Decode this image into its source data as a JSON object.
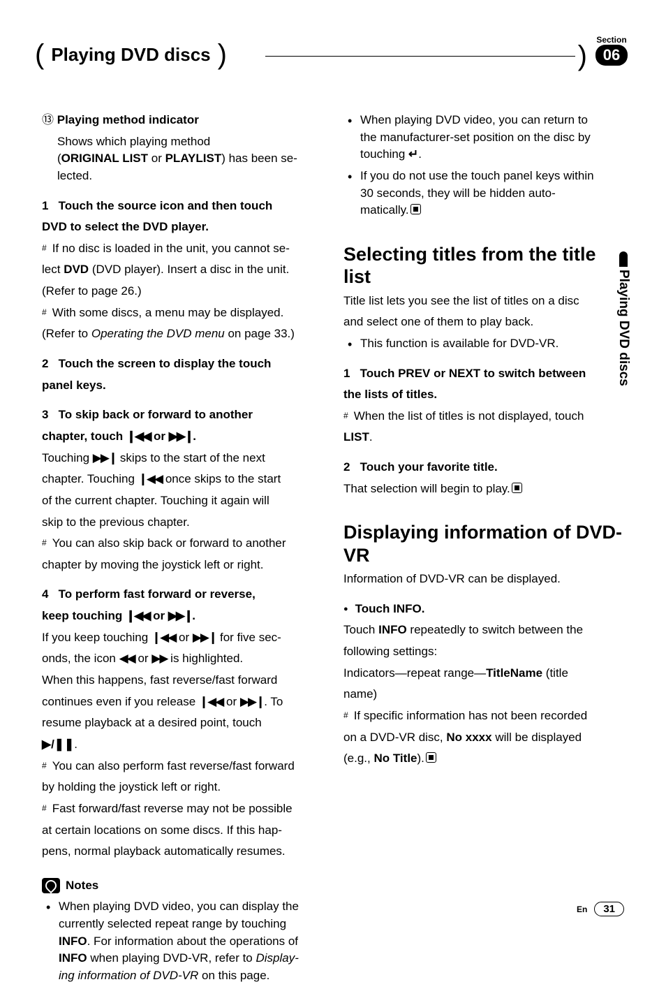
{
  "header": {
    "section_title": "Playing DVD discs",
    "section_label": "Section",
    "section_number": "06"
  },
  "side_tab": "Playing DVD discs",
  "left": {
    "item13_num": "⑬",
    "item13_title": "Playing method indicator",
    "item13_l1": "Shows which playing method",
    "item13_l2a": "(",
    "item13_l2b": "ORIGINAL LIST",
    "item13_l2c": " or ",
    "item13_l2d": "PLAYLIST",
    "item13_l2e": ") has been se-",
    "item13_l3": "lected.",
    "s1_num": "1",
    "s1_t1": "Touch the source icon and then touch",
    "s1_t2": "DVD to select the DVD player.",
    "s1_n1a": "If no disc is loaded in the unit, you cannot se-",
    "s1_n1b": "lect ",
    "s1_n1c": "DVD",
    "s1_n1d": " (DVD player). Insert a disc in the unit.",
    "s1_n1e": "(Refer to page 26.)",
    "s1_n2a": "With some discs, a menu may be displayed.",
    "s1_n2b": "(Refer to ",
    "s1_n2c": "Operating the DVD menu",
    "s1_n2d": " on page 33.)",
    "s2_num": "2",
    "s2_t1": "Touch the screen to display the touch",
    "s2_t2": "panel keys.",
    "s3_num": "3",
    "s3_t1": "To skip back or forward to another",
    "s3_t2a": "chapter, touch ",
    "s3_t2b": " or ",
    "s3_t2c": ".",
    "s3_b1a": "Touching ",
    "s3_b1b": " skips to the start of the next",
    "s3_b2a": "chapter. Touching ",
    "s3_b2b": " once skips to the start",
    "s3_b3": "of the current chapter. Touching it again will",
    "s3_b4": "skip to the previous chapter.",
    "s3_n1a": "You can also skip back or forward to another",
    "s3_n1b": "chapter by moving the joystick left or right.",
    "s4_num": "4",
    "s4_t1": "To perform fast forward or reverse,",
    "s4_t2a": "keep touching ",
    "s4_t2b": " or ",
    "s4_t2c": ".",
    "s4_b1a": "If you keep touching ",
    "s4_b1b": " or ",
    "s4_b1c": " for five sec-",
    "s4_b2a": "onds, the icon ",
    "s4_b2b": " or ",
    "s4_b2c": " is highlighted.",
    "s4_b3": "When this happens, fast reverse/fast forward",
    "s4_b4a": "continues even if you release ",
    "s4_b4b": " or ",
    "s4_b4c": ". To",
    "s4_b5": "resume playback at a desired point, touch",
    "s4_b6": "▶/❚❚",
    "s4_b6b": ".",
    "s4_n1a": "You can also perform fast reverse/fast forward",
    "s4_n1b": "by holding the joystick left or right.",
    "s4_n2a": "Fast forward/fast reverse may not be possible",
    "s4_n2b": "at certain locations on some discs. If this hap-",
    "s4_n2c": "pens, normal playback automatically resumes.",
    "notes_title": "Notes",
    "note_a1": "When playing DVD video, you can display the",
    "note_a2": "currently selected repeat range by touching",
    "note_a3a": "INFO",
    "note_a3b": ". For information about the operations of",
    "note_a4a": "INFO",
    "note_a4b": " when playing DVD-VR, refer to ",
    "note_a4c": "Display-",
    "note_a5a": "ing information of DVD-VR",
    "note_a5b": " on this page."
  },
  "right": {
    "note_b1": "When playing DVD video, you can return to",
    "note_b2": "the manufacturer-set position on the disc by",
    "note_b3a": "touching ",
    "note_b3b": "↵",
    "note_b3c": ".",
    "note_c1": "If you do not use the touch panel keys within",
    "note_c2": "30 seconds, they will be hidden auto-",
    "note_c3": "matically.",
    "h2a": "Selecting titles from the title list",
    "h2a_b1": "Title list lets you see the list of titles on a disc",
    "h2a_b2": "and select one of them to play back.",
    "h2a_li": "This function is available for DVD-VR.",
    "h2a_s1n": "1",
    "h2a_s1a": "Touch PREV or NEXT to switch between",
    "h2a_s1b": "the lists of titles.",
    "h2a_s1na": "When the list of titles is not displayed, touch",
    "h2a_s1nb": "LIST",
    "h2a_s1nc": ".",
    "h2a_s2n": "2",
    "h2a_s2a": "Touch your favorite title.",
    "h2a_s2b": "That selection will begin to play.",
    "h2b": "Displaying information of DVD-VR",
    "h2b_b1": "Information of DVD-VR can be displayed.",
    "h2b_s_t": "Touch INFO.",
    "h2b_s_b1a": "Touch ",
    "h2b_s_b1b": "INFO",
    "h2b_s_b1c": " repeatedly to switch between the",
    "h2b_s_b2": "following settings:",
    "h2b_s_b3a": "Indicators—repeat range—",
    "h2b_s_b3b": "TitleName",
    "h2b_s_b3c": " (title",
    "h2b_s_b4": "name)",
    "h2b_n1a": "If specific information has not been recorded",
    "h2b_n1b": "on a DVD-VR disc, ",
    "h2b_n1c": "No xxxx",
    "h2b_n1d": " will be displayed",
    "h2b_n1e": "(e.g., ",
    "h2b_n1f": "No Title",
    "h2b_n1g": ")."
  },
  "glyph": {
    "prev": "❙◀◀",
    "next": "▶▶❙",
    "rew": "◀◀",
    "ff": "▶▶"
  },
  "footer": {
    "lang": "En",
    "page": "31"
  }
}
